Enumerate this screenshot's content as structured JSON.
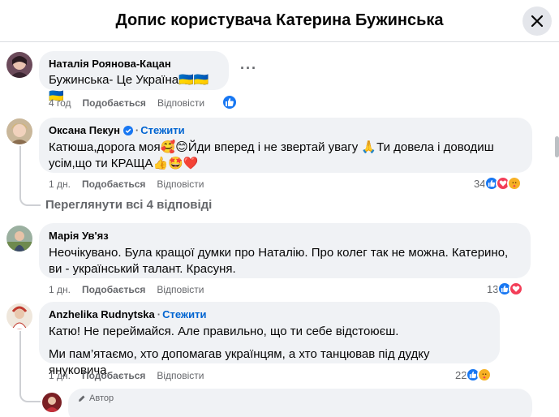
{
  "header": {
    "title": "Допис користувача Катерина Бужинська"
  },
  "comments": [
    {
      "author": "Наталія Роянова-Кацан",
      "text": "Бужинська- Це Україна🇺🇦🇺🇦🇺🇦",
      "time": "4 год",
      "like_label": "Подобається",
      "reply_label": "Відповісти"
    },
    {
      "author": "Оксана Пекун",
      "follow_label": "Стежити",
      "text_line1": "Катюша,дорога моя🥰😊Йди вперед і не звертай увагу 🙏Ти довела і доводиш",
      "text_line2": "усім,що ти КРАЩА👍🤩❤️",
      "time": "1 дн.",
      "like_label": "Подобається",
      "reply_label": "Відповісти",
      "reaction_count": "34"
    },
    {
      "author": "Марія Ув'яз",
      "text_line1": "Неочікувано. Була кращої думки про Наталію. Про колег так не можна. Катерино,",
      "text_line2": "ви - український талант. Красуня.",
      "time": "1 дн.",
      "like_label": "Подобається",
      "reply_label": "Відповісти",
      "reaction_count": "13"
    },
    {
      "author": "Anzhelika Rudnytska",
      "follow_label": "Стежити",
      "text_line1": "Катю! Не переймайся. Але правильно, що ти себе відстоюєш.",
      "text_line2": "Ми пам’ятаємо, хто допомагав українцям, а хто танцював під дудку януковича.",
      "time": "1 дн.",
      "like_label": "Подобається",
      "reply_label": "Відповісти",
      "reaction_count": "22"
    }
  ],
  "view_replies": "Переглянути всі 4 відповіді",
  "reply_preview": {
    "badge": "Автор"
  },
  "icons": {
    "close": "close-icon",
    "more": "more-options-icon",
    "verified": "verified-badge-icon",
    "like": "like-reaction-icon",
    "love": "love-reaction-icon",
    "care": "care-reaction-icon",
    "author_badge": "pen-icon"
  },
  "colors": {
    "accent": "#1877f2",
    "follow": "#0064d1",
    "bubble": "#f0f2f5",
    "muted": "#65676b",
    "love": "#f33e58",
    "care": "#f7b125"
  }
}
